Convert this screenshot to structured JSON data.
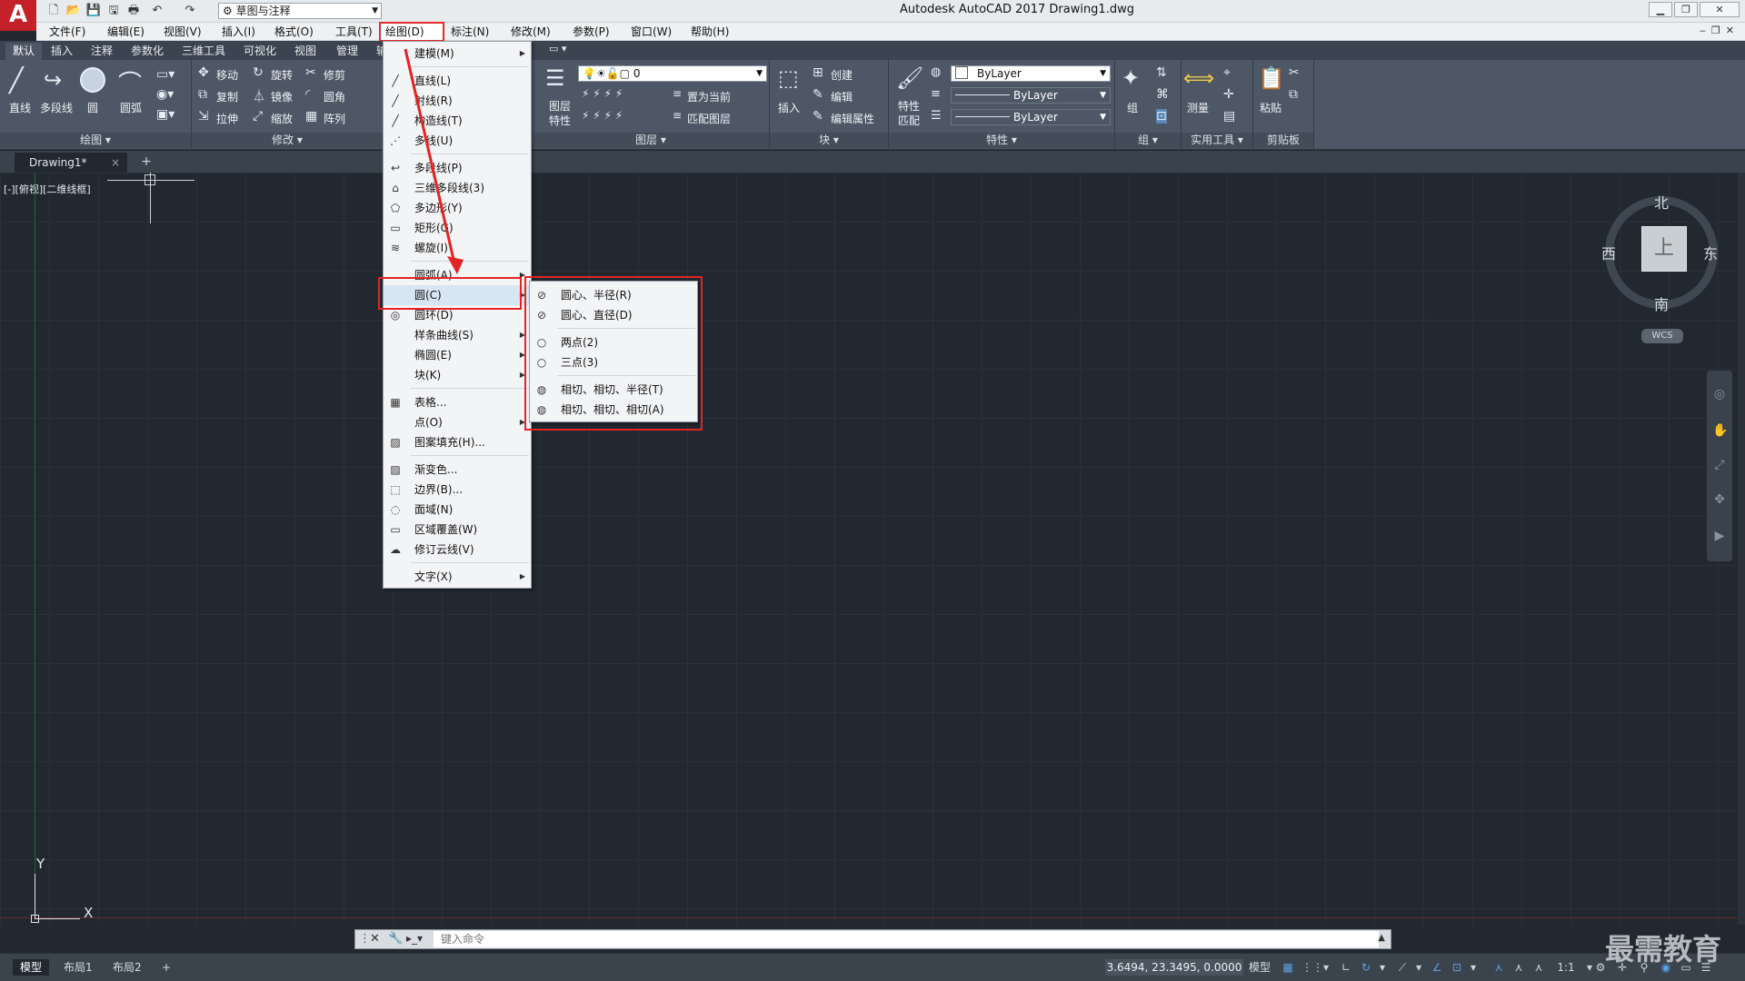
{
  "app": {
    "title": "Autodesk AutoCAD 2017    Drawing1.dwg",
    "logo": "A",
    "workspace": "草图与注释",
    "accent": "#c3202a",
    "highlight": "#e52323"
  },
  "menubar": [
    "文件(F)",
    "编辑(E)",
    "视图(V)",
    "插入(I)",
    "格式(O)",
    "工具(T)",
    "绘图(D)",
    "标注(N)",
    "修改(M)",
    "参数(P)",
    "窗口(W)",
    "帮助(H)"
  ],
  "ribbon": {
    "tabs": [
      "默认",
      "插入",
      "注释",
      "参数化",
      "三维工具",
      "可视化",
      "视图",
      "管理",
      "输"
    ],
    "draw": {
      "title": "绘图",
      "line": "直线",
      "polyline": "多段线",
      "circle": "圆",
      "arc": "圆弧"
    },
    "modify": {
      "title": "修改",
      "move": "移动",
      "rotate": "旋转",
      "trim": "修剪",
      "copy": "复制",
      "mirror": "镜像",
      "fillet": "圆角",
      "stretch": "拉伸",
      "scale": "缩放",
      "array": "阵列"
    },
    "layers": {
      "title": "图层",
      "layer_props_1": "图层",
      "layer_props_2": "特性",
      "current_layer": "0",
      "set_current": "置为当前",
      "match_layer": "匹配图层"
    },
    "block": {
      "title": "块",
      "insert": "插入",
      "create": "创建",
      "edit": "编辑",
      "edit_attr": "编辑属性"
    },
    "properties": {
      "title": "特性",
      "match_1": "特性",
      "match_2": "匹配",
      "color": "ByLayer",
      "linetype": "ByLayer",
      "lineweight": "ByLayer"
    },
    "groups": {
      "title": "组",
      "group": "组"
    },
    "utilities": {
      "title": "实用工具",
      "measure": "测量"
    },
    "clipboard": {
      "title": "剪贴板",
      "paste": "粘贴"
    }
  },
  "file_tab": {
    "name": "Drawing1*",
    "close": "×",
    "new": "+"
  },
  "viewport_label": "[-][俯视][二维线框]",
  "viewcube": {
    "north": "北",
    "south": "南",
    "east": "东",
    "west": "西",
    "top": "上",
    "wcs": "WCS"
  },
  "ucs": {
    "x": "X",
    "y": "Y"
  },
  "draw_menu": {
    "items": [
      {
        "icon": "",
        "label": "建模(M)",
        "submenu": true
      },
      {
        "icon": "╱",
        "label": "直线(L)"
      },
      {
        "icon": "╱",
        "label": "射线(R)"
      },
      {
        "icon": "╱",
        "label": "构造线(T)"
      },
      {
        "icon": "⋰",
        "label": "多线(U)"
      },
      {
        "icon": "↩",
        "label": "多段线(P)"
      },
      {
        "icon": "⌂",
        "label": "三维多段线(3)"
      },
      {
        "icon": "⬠",
        "label": "多边形(Y)"
      },
      {
        "icon": "▭",
        "label": "矩形(G)"
      },
      {
        "icon": "≋",
        "label": "螺旋(I)"
      },
      {
        "icon": "",
        "label": "圆弧(A)",
        "submenu": true
      },
      {
        "icon": "",
        "label": "圆(C)",
        "submenu": true
      },
      {
        "icon": "◎",
        "label": "圆环(D)"
      },
      {
        "icon": "",
        "label": "样条曲线(S)",
        "submenu": true
      },
      {
        "icon": "",
        "label": "椭圆(E)",
        "submenu": true
      },
      {
        "icon": "",
        "label": "块(K)",
        "submenu": true
      },
      {
        "icon": "▦",
        "label": "表格..."
      },
      {
        "icon": "",
        "label": "点(O)",
        "submenu": true
      },
      {
        "icon": "▨",
        "label": "图案填充(H)..."
      },
      {
        "icon": "▨",
        "label": "渐变色..."
      },
      {
        "icon": "⬚",
        "label": "边界(B)..."
      },
      {
        "icon": "◌",
        "label": "面域(N)"
      },
      {
        "icon": "▭",
        "label": "区域覆盖(W)"
      },
      {
        "icon": "☁",
        "label": "修订云线(V)"
      },
      {
        "icon": "",
        "label": "文字(X)",
        "submenu": true
      }
    ]
  },
  "circle_submenu": {
    "items": [
      {
        "icon": "⊘",
        "label": "圆心、半径(R)"
      },
      {
        "icon": "⊘",
        "label": "圆心、直径(D)"
      },
      {
        "icon": "○",
        "label": "两点(2)"
      },
      {
        "icon": "○",
        "label": "三点(3)"
      },
      {
        "icon": "◍",
        "label": "相切、相切、半径(T)"
      },
      {
        "icon": "◍",
        "label": "相切、相切、相切(A)"
      }
    ]
  },
  "command_line": {
    "placeholder": "键入命令"
  },
  "statusbar": {
    "tabs": [
      "模型",
      "布局1",
      "布局2"
    ],
    "add": "+",
    "coords": "3.6494, 23.3495, 0.0000",
    "model": "模型",
    "scale": "1:1"
  },
  "watermark": "最需教育"
}
